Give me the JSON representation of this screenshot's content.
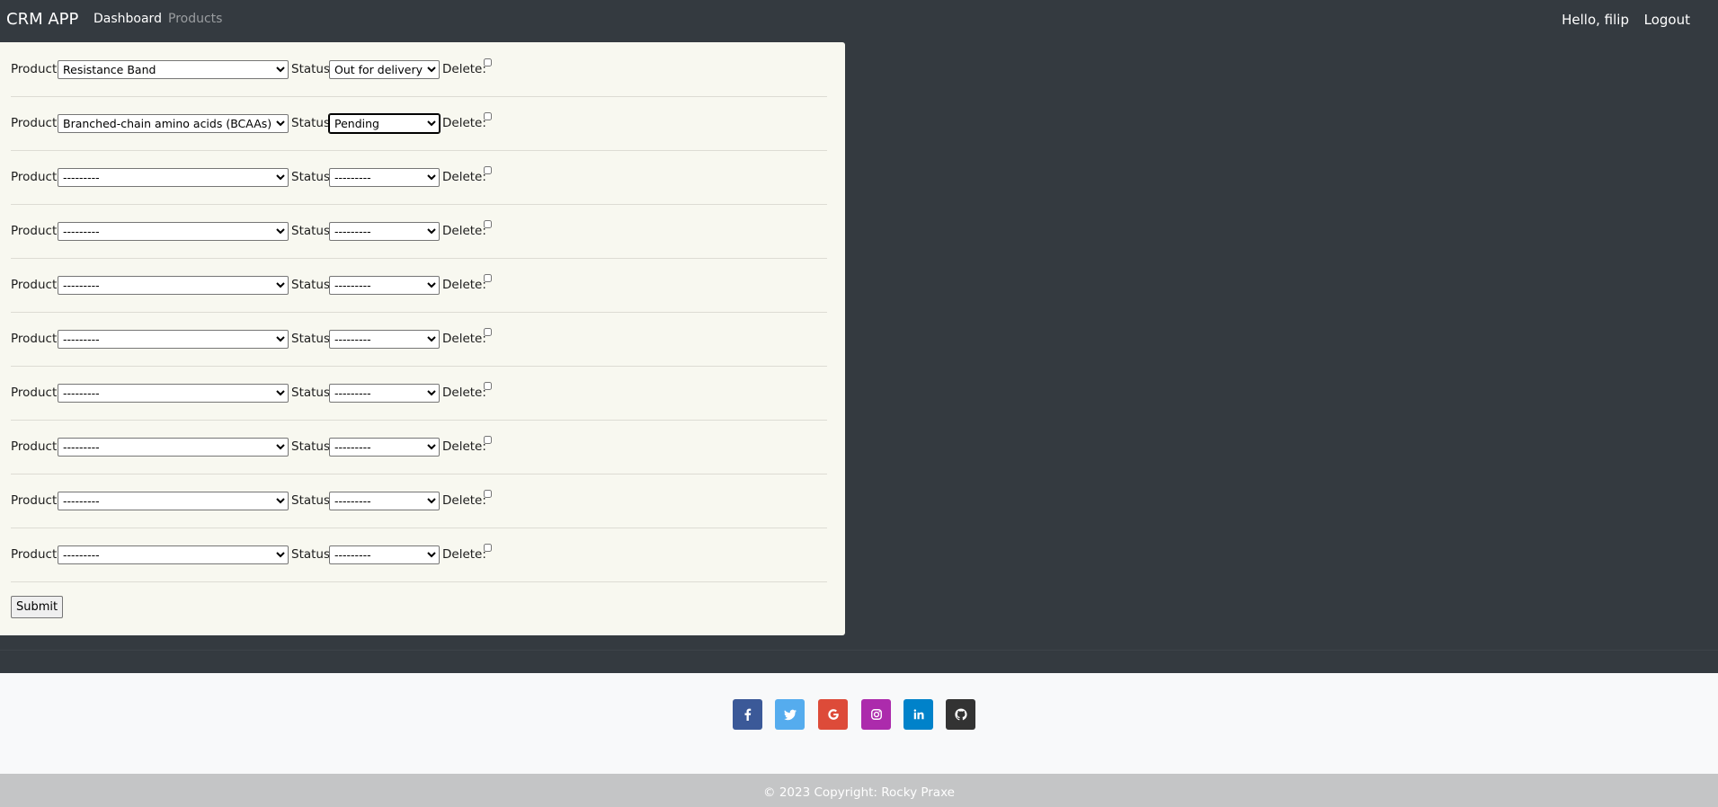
{
  "navbar": {
    "brand": "CRM APP",
    "links": [
      "Dashboard",
      "Products"
    ],
    "greeting": "Hello, filip",
    "logout": "Logout"
  },
  "form": {
    "labels": {
      "product": "Product:",
      "status": "Status:",
      "delete": "Delete:"
    },
    "rows": [
      {
        "product": "Resistance Band",
        "status": "Out for delivery",
        "delete": false
      },
      {
        "product": "Branched-chain amino acids (BCAAs)",
        "status": "Pending",
        "delete": false
      },
      {
        "product": "---------",
        "status": "---------",
        "delete": false
      },
      {
        "product": "---------",
        "status": "---------",
        "delete": false
      },
      {
        "product": "---------",
        "status": "---------",
        "delete": false
      },
      {
        "product": "---------",
        "status": "---------",
        "delete": false
      },
      {
        "product": "---------",
        "status": "---------",
        "delete": false
      },
      {
        "product": "---------",
        "status": "---------",
        "delete": false
      },
      {
        "product": "---------",
        "status": "---------",
        "delete": false
      },
      {
        "product": "---------",
        "status": "---------",
        "delete": false
      }
    ],
    "submit_label": "Submit"
  },
  "footer": {
    "social": [
      {
        "icon": "facebook-icon",
        "color": "#3b5998"
      },
      {
        "icon": "twitter-icon",
        "color": "#55acee"
      },
      {
        "icon": "google-icon",
        "color": "#dd4b39"
      },
      {
        "icon": "instagram-icon",
        "color": "#ac2bac"
      },
      {
        "icon": "linkedin-icon",
        "color": "#0082ca"
      },
      {
        "icon": "github-icon",
        "color": "#333333"
      }
    ],
    "copyright": "© 2023 Copyright: Rocky Praxe"
  },
  "colors": {
    "navbar_bg": "#343a40",
    "card_bg": "#f8f8f0",
    "footer_bg": "#f8f9fa",
    "copyright_bg": "#c4c5c6"
  }
}
